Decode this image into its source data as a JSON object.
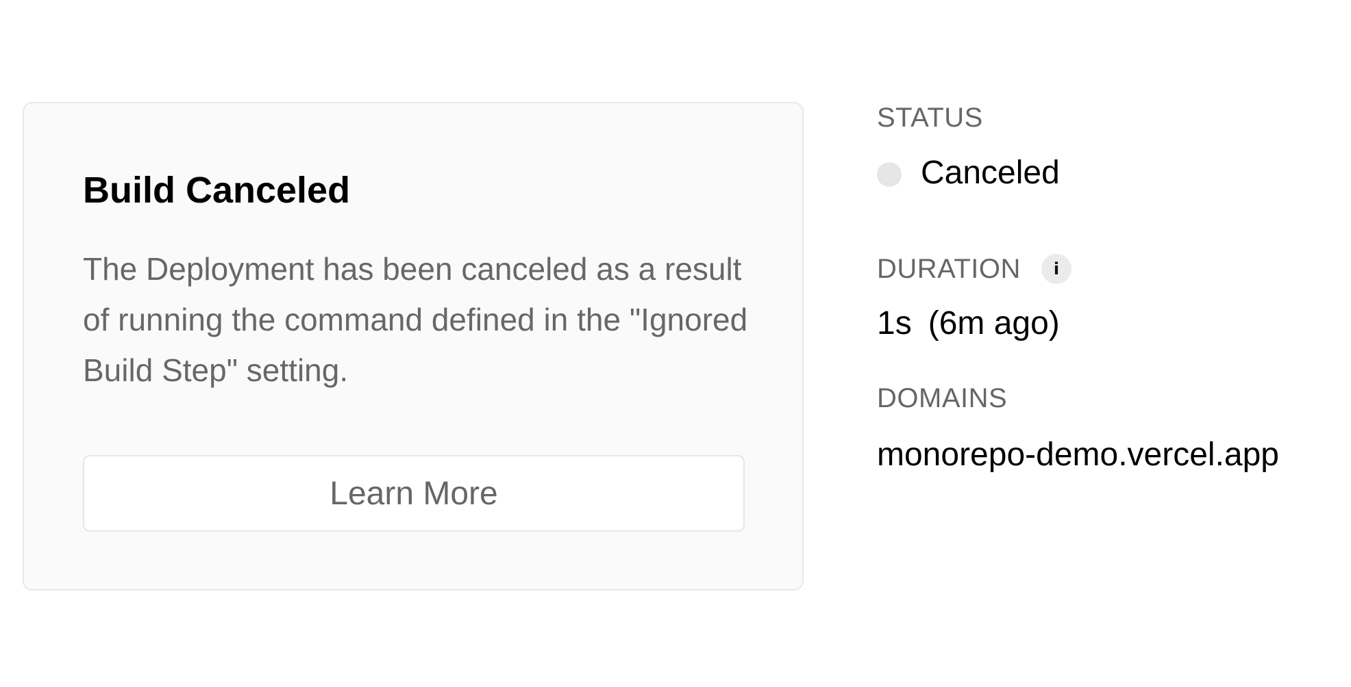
{
  "notice": {
    "title": "Build Canceled",
    "description": "The Deployment has been canceled as a result of running the command defined in the \"Ignored Build Step\" setting.",
    "button_label": "Learn More"
  },
  "meta": {
    "status_label": "STATUS",
    "status_value": "Canceled",
    "status_color": "#e6e6e6",
    "duration_label": "DURATION",
    "duration_info_icon": "info-icon",
    "duration_info_glyph": "i",
    "duration_value": "1s",
    "duration_relative": "(6m ago)",
    "domains_label": "DOMAINS",
    "domains": [
      "monorepo-demo.vercel.app"
    ]
  }
}
